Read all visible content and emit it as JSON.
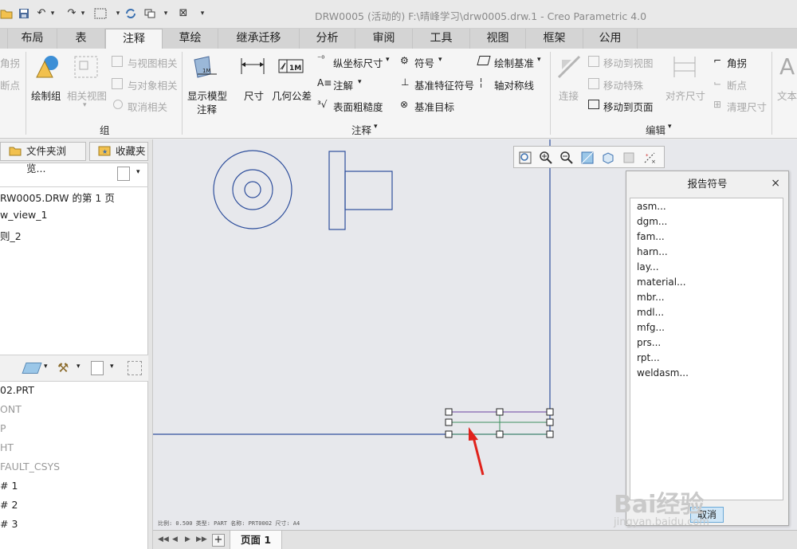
{
  "window": {
    "title": "DRW0005 (活动的) F:\\晴峰学习\\drw0005.drw.1 - Creo Parametric 4.0"
  },
  "tabs": [
    {
      "label": "布局"
    },
    {
      "label": "表"
    },
    {
      "label": "注释"
    },
    {
      "label": "草绘"
    },
    {
      "label": "继承迁移"
    },
    {
      "label": "分析"
    },
    {
      "label": "审阅"
    },
    {
      "label": "工具"
    },
    {
      "label": "视图"
    },
    {
      "label": "框架"
    },
    {
      "label": "公用"
    }
  ],
  "ribbon": {
    "left_partial": {
      "corner": "角拐",
      "breakpoint": "断点"
    },
    "group_group": {
      "label": "组",
      "draw_group": "绘制组",
      "related_view": "相关视图",
      "relate_to_view": "与视图相关",
      "relate_to_object": "与对象相关",
      "cancel_relation": "取消相关"
    },
    "group_annotate": {
      "label": "注释",
      "show_model_annotation_line1": "显示模型",
      "show_model_annotation_line2": "注释",
      "dimension": "尺寸",
      "gtol": "几何公差",
      "ordinate_dimension": "纵坐标尺寸",
      "note": "注解",
      "surface_finish": "表面粗糙度",
      "symbol": "符号",
      "datum_feature_symbol": "基准特征符号",
      "datum_target": "基准目标",
      "draw_datum": "绘制基准",
      "axis_of_symmetry": "轴对称线"
    },
    "group_edit": {
      "label": "编辑",
      "connect": "连接",
      "move_to_view": "移动到视图",
      "move_special": "移动特殊",
      "move_to_page": "移动到页面",
      "align_dimensions": "对齐尺寸",
      "corner": "角拐",
      "breakpoint": "断点",
      "clean_dimensions": "清理尺寸"
    },
    "right_partial": {
      "text": "文本"
    }
  },
  "left_panel": {
    "tab_folder": "文件夹浏览...",
    "tab_favorites": "收藏夹",
    "drawing_tree": [
      {
        "label": "RW0005.DRW 的第 1 页",
        "dim": false
      },
      {
        "label": "w_view_1",
        "dim": false
      },
      {
        "label": "则_2",
        "dim": false
      }
    ],
    "model_tree": [
      {
        "label": "02.PRT",
        "dim": false
      },
      {
        "label": "ONT",
        "dim": true
      },
      {
        "label": "P",
        "dim": true
      },
      {
        "label": "HT",
        "dim": true
      },
      {
        "label": "FAULT_CSYS",
        "dim": true
      },
      {
        "label": "# 1",
        "dim": false
      },
      {
        "label": "# 2",
        "dim": false
      },
      {
        "label": "# 3",
        "dim": false
      }
    ]
  },
  "report_dialog": {
    "title": "报告符号",
    "close": "×",
    "items": [
      "asm...",
      "dgm...",
      "fam...",
      "harn...",
      "lay...",
      "material...",
      "mbr...",
      "mdl...",
      "mfg...",
      "prs...",
      "rpt...",
      "weldasm..."
    ],
    "cancel": "取消"
  },
  "status": {
    "info": "比例: 0.500    类型: PART    名称: PRT0002    尺寸: A4"
  },
  "page": {
    "tab_label": "页面 1",
    "add": "+"
  },
  "watermark": {
    "main": "Bai经验",
    "sub": "jingyan.baidu.com"
  },
  "colors": {
    "drawing_line": "#2f4f9c",
    "table_line": "#3f8f5f",
    "selection_arrow": "#e0221b",
    "active_button": "#cfe6f7"
  }
}
